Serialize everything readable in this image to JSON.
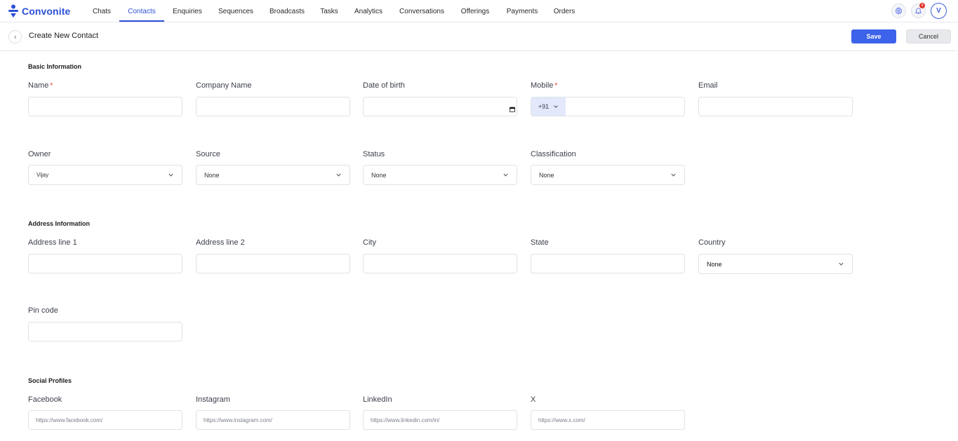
{
  "brand": {
    "name": "Convonite",
    "color": "#2b50d6",
    "icon": "person-dot-icon"
  },
  "nav": {
    "items": [
      "Chats",
      "Contacts",
      "Enquiries",
      "Sequences",
      "Broadcasts",
      "Tasks",
      "Analytics",
      "Conversations",
      "Offerings",
      "Payments",
      "Orders"
    ],
    "active": "Contacts"
  },
  "header_right": {
    "settings_icon": "gear-icon",
    "notification_icon": "bell-icon",
    "notification_count": "9",
    "avatar_initial": "V"
  },
  "page": {
    "title": "Create New Contact",
    "back_icon": "chevron-left-icon"
  },
  "actions": {
    "save": "Save",
    "cancel": "Cancel"
  },
  "basic": {
    "title": "Basic Information",
    "name_label": "Name",
    "company_label": "Company Name",
    "dob_label": "Date of birth",
    "mobile_label": "Mobile",
    "country_code": "+91",
    "email_label": "Email",
    "owner_label": "Owner",
    "owner_value": "Vijay",
    "source_label": "Source",
    "source_value": "None",
    "status_label": "Status",
    "status_value": "None",
    "classification_label": "Classification",
    "classification_value": "None",
    "required_mark": "*"
  },
  "address": {
    "title": "Address Information",
    "line1_label": "Address line 1",
    "line2_label": "Address line 2",
    "city_label": "City",
    "state_label": "State",
    "country_label": "Country",
    "country_value": "None",
    "pincode_label": "Pin code"
  },
  "social": {
    "title": "Social Profiles",
    "facebook_label": "Facebook",
    "facebook_placeholder": "https://www.facebook.com/",
    "instagram_label": "Instagram",
    "instagram_placeholder": "https://www.instagram.com/",
    "linkedin_label": "LinkedIn",
    "linkedin_placeholder": "https://www.linkedin.com/in/",
    "x_label": "X",
    "x_placeholder": "https://www.x.com/"
  },
  "colors": {
    "accent": "#3d63ea",
    "required": "#e5372b",
    "border": "#dfe2e8",
    "country_code_bg": "#e3e9fb"
  }
}
